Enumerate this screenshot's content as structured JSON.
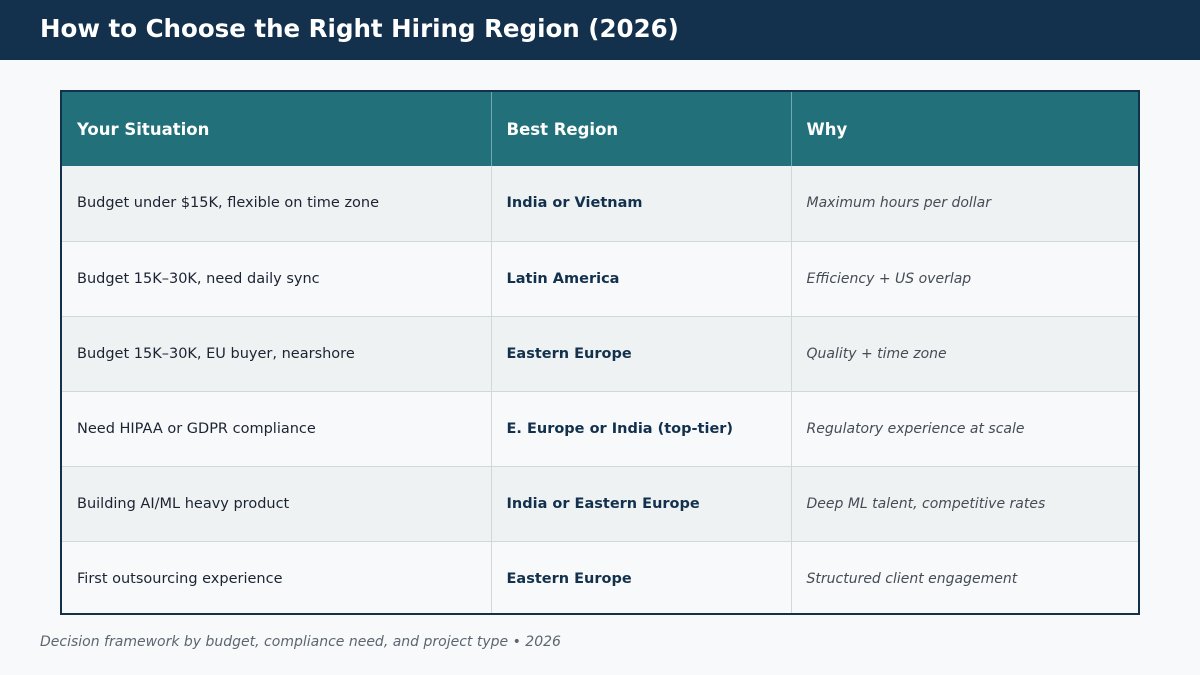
{
  "title": "How to Choose the Right Hiring Region (2026)",
  "table": {
    "headers": [
      "Your Situation",
      "Best Region",
      "Why"
    ],
    "rows": [
      {
        "situation": "Budget under $15K, flexible on time zone",
        "region": "India or Vietnam",
        "why": "Maximum hours per dollar"
      },
      {
        "situation": "Budget 15K–30K, need daily sync",
        "region": "Latin America",
        "why": "Efficiency + US overlap"
      },
      {
        "situation": "Budget 15K–30K, EU buyer, nearshore",
        "region": "Eastern Europe",
        "why": "Quality + time zone"
      },
      {
        "situation": "Need HIPAA or GDPR compliance",
        "region": "E. Europe or India (top-tier)",
        "why": "Regulatory experience at scale"
      },
      {
        "situation": "Building AI/ML heavy product",
        "region": "India or Eastern Europe",
        "why": "Deep ML talent, competitive rates"
      },
      {
        "situation": "First outsourcing experience",
        "region": "Eastern Europe",
        "why": "Structured client engagement"
      }
    ]
  },
  "footnote": "Decision framework by budget, compliance need, and project type  •  2026",
  "colors": {
    "title_bar": "#13314d",
    "header_row": "#21707a",
    "row_alt": "#eef2f3",
    "region_text": "#13314d"
  }
}
